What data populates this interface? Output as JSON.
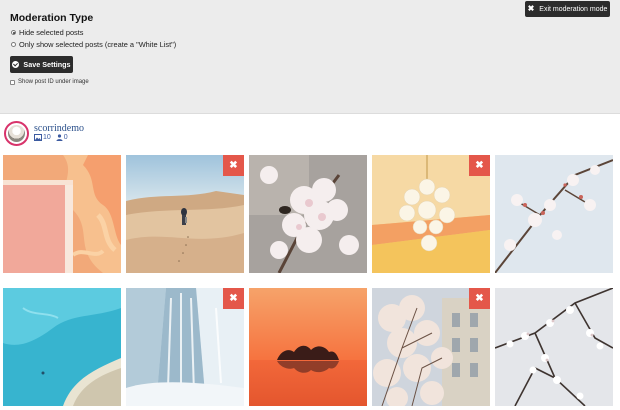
{
  "moderation": {
    "title": "Moderation Type",
    "options": [
      {
        "label": "Hide selected posts",
        "selected": true
      },
      {
        "label": "Only show selected posts (create a \"White List\")",
        "selected": false
      }
    ],
    "save_label": "Save Settings",
    "show_post_id_label": "Show post ID under image",
    "show_post_id_checked": false,
    "exit_label": "Exit moderation mode"
  },
  "feed": {
    "username": "scorrindemo",
    "posts_count": "10",
    "followers_count": "0"
  },
  "posts": [
    {
      "name": "pink-wall-photo",
      "hide_visible": false
    },
    {
      "name": "desert-walker-photo",
      "hide_visible": true
    },
    {
      "name": "cherry-blossom-bee-photo",
      "hide_visible": false
    },
    {
      "name": "globe-chandelier-photo",
      "hide_visible": true
    },
    {
      "name": "blossom-branch-sky-photo",
      "hide_visible": false
    },
    {
      "name": "turquoise-lagoon-photo",
      "hide_visible": false
    },
    {
      "name": "frozen-waterfall-photo",
      "hide_visible": true
    },
    {
      "name": "sunset-island-photo",
      "hide_visible": false
    },
    {
      "name": "blossom-building-photo",
      "hide_visible": true
    },
    {
      "name": "blossom-branches-photo",
      "hide_visible": false
    }
  ],
  "hide_button_symbol": "✖",
  "colors": {
    "hide_button": "#e4574a",
    "dark_button": "#2c2c2c",
    "link": "#2a4f8a",
    "avatar_ring": "#d8336b"
  }
}
